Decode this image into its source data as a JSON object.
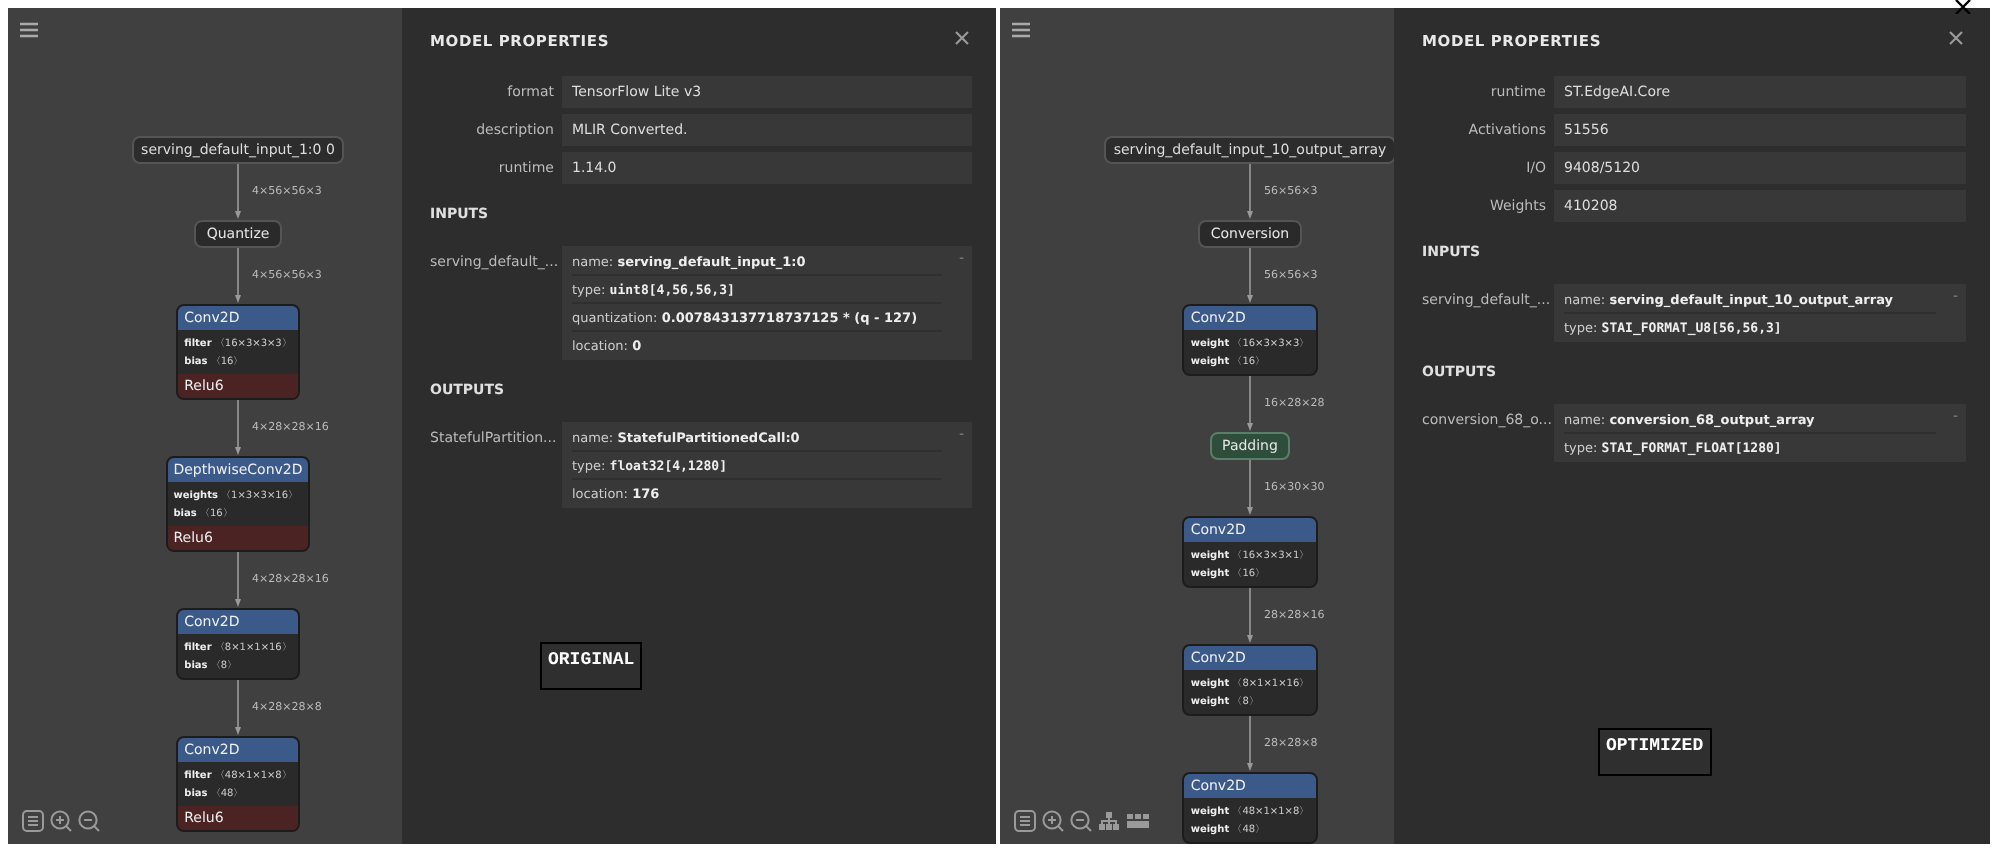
{
  "panels": [
    {
      "graph": [
        {
          "kind": "input",
          "title": "serving_default_input_1:0 0"
        },
        {
          "kind": "edge",
          "label": "4×56×56×3"
        },
        {
          "kind": "plain",
          "title": "Quantize"
        },
        {
          "kind": "edge",
          "label": "4×56×56×3"
        },
        {
          "kind": "op",
          "title": "Conv2D",
          "attributes": [
            {
              "name": "filter",
              "value": "〈16×3×3×3〉"
            },
            {
              "name": "bias",
              "value": "〈16〉"
            }
          ],
          "activation": "Relu6"
        },
        {
          "kind": "edge",
          "label": "4×28×28×16"
        },
        {
          "kind": "op",
          "title": "DepthwiseConv2D",
          "attributes": [
            {
              "name": "weights",
              "value": "〈1×3×3×16〉"
            },
            {
              "name": "bias",
              "value": "〈16〉"
            }
          ],
          "activation": "Relu6"
        },
        {
          "kind": "edge",
          "label": "4×28×28×16"
        },
        {
          "kind": "op",
          "title": "Conv2D",
          "attributes": [
            {
              "name": "filter",
              "value": "〈8×1×1×16〉"
            },
            {
              "name": "bias",
              "value": "〈8〉"
            }
          ]
        },
        {
          "kind": "edge",
          "label": "4×28×28×8"
        },
        {
          "kind": "op",
          "title": "Conv2D",
          "attributes": [
            {
              "name": "filter",
              "value": "〈48×1×1×8〉"
            },
            {
              "name": "bias",
              "value": "〈48〉"
            }
          ],
          "activation": "Relu6"
        }
      ],
      "toolbar": [
        {
          "kind": "list"
        },
        {
          "kind": "zoom-in"
        },
        {
          "kind": "zoom-out"
        }
      ],
      "properties": {
        "title": "MODEL PROPERTIES",
        "fields": [
          {
            "label": "format",
            "value": "TensorFlow Lite v3"
          },
          {
            "label": "description",
            "value": "MLIR Converted."
          },
          {
            "label": "runtime",
            "value": "1.14.0"
          }
        ],
        "sections": [
          {
            "title": "INPUTS",
            "entries": [
              {
                "label": "serving_default_...",
                "toggle": "-",
                "lines": [
                  {
                    "label": "name:",
                    "value": "serving_default_input_1:0",
                    "kind": "text"
                  },
                  {
                    "label": "type:",
                    "value": "uint8[4,56,56,3]",
                    "kind": "code"
                  },
                  {
                    "label": "quantization:",
                    "value": "0.007843137718737125 * (q - 127)",
                    "kind": "text"
                  },
                  {
                    "label": "location:",
                    "value": "0",
                    "kind": "text"
                  }
                ]
              }
            ]
          },
          {
            "title": "OUTPUTS",
            "entries": [
              {
                "label": "StatefulPartition...",
                "toggle": "-",
                "lines": [
                  {
                    "label": "name:",
                    "value": "StatefulPartitionedCall:0",
                    "kind": "text"
                  },
                  {
                    "label": "type:",
                    "value": "float32[4,1280]",
                    "kind": "code"
                  },
                  {
                    "label": "location:",
                    "value": "176",
                    "kind": "text"
                  }
                ]
              }
            ]
          }
        ]
      },
      "caption": "ORIGINAL"
    },
    {
      "graph": [
        {
          "kind": "input",
          "title": "serving_default_input_10_output_array"
        },
        {
          "kind": "edge",
          "label": "56×56×3"
        },
        {
          "kind": "plain",
          "title": "Conversion"
        },
        {
          "kind": "edge",
          "label": "56×56×3"
        },
        {
          "kind": "op",
          "title": "Conv2D",
          "attributes": [
            {
              "name": "weight",
              "value": "〈16×3×3×3〉"
            },
            {
              "name": "weight",
              "value": "〈16〉"
            }
          ]
        },
        {
          "kind": "edge",
          "label": "16×28×28"
        },
        {
          "kind": "padding",
          "title": "Padding"
        },
        {
          "kind": "edge",
          "label": "16×30×30"
        },
        {
          "kind": "op",
          "title": "Conv2D",
          "attributes": [
            {
              "name": "weight",
              "value": "〈16×3×3×1〉"
            },
            {
              "name": "weight",
              "value": "〈16〉"
            }
          ]
        },
        {
          "kind": "edge",
          "label": "28×28×16"
        },
        {
          "kind": "op",
          "title": "Conv2D",
          "attributes": [
            {
              "name": "weight",
              "value": "〈8×1×1×16〉"
            },
            {
              "name": "weight",
              "value": "〈8〉"
            }
          ]
        },
        {
          "kind": "edge",
          "label": "28×28×8"
        },
        {
          "kind": "op",
          "title": "Conv2D",
          "attributes": [
            {
              "name": "weight",
              "value": "〈48×1×1×8〉"
            },
            {
              "name": "weight",
              "value": "〈48〉"
            }
          ]
        }
      ],
      "toolbar": [
        {
          "kind": "list"
        },
        {
          "kind": "zoom-in"
        },
        {
          "kind": "zoom-out"
        },
        {
          "kind": "hierarchy"
        },
        {
          "kind": "layout"
        }
      ],
      "properties": {
        "title": "MODEL PROPERTIES",
        "fields": [
          {
            "label": "runtime",
            "value": "ST.EdgeAI.Core"
          },
          {
            "label": "Activations",
            "value": "51556"
          },
          {
            "label": "I/O",
            "value": "9408/5120"
          },
          {
            "label": "Weights",
            "value": "410208"
          }
        ],
        "sections": [
          {
            "title": "INPUTS",
            "entries": [
              {
                "label": "serving_default_...",
                "toggle": "-",
                "lines": [
                  {
                    "label": "name:",
                    "value": "serving_default_input_10_output_array",
                    "kind": "text"
                  },
                  {
                    "label": "type:",
                    "value": "STAI_FORMAT_U8[56,56,3]",
                    "kind": "code"
                  }
                ]
              }
            ]
          },
          {
            "title": "OUTPUTS",
            "entries": [
              {
                "label": "conversion_68_o...",
                "toggle": "-",
                "lines": [
                  {
                    "label": "name:",
                    "value": "conversion_68_output_array",
                    "kind": "text"
                  },
                  {
                    "label": "type:",
                    "value": "STAI_FORMAT_FLOAT[1280]",
                    "kind": "code"
                  }
                ]
              }
            ]
          }
        ]
      },
      "caption": "OPTIMIZED"
    }
  ]
}
